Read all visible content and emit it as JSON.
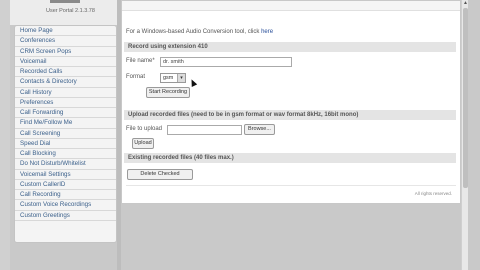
{
  "app": {
    "version": "User Portal 2.1.3.78"
  },
  "sidebar": {
    "items": [
      {
        "label": "Home Page"
      },
      {
        "label": "Conferences"
      },
      {
        "label": "CRM Screen Pops"
      },
      {
        "label": "Voicemail"
      },
      {
        "label": "Recorded Calls"
      },
      {
        "label": "Contacts & Directory"
      },
      {
        "label": "Call History"
      },
      {
        "label": "Preferences"
      },
      {
        "label": "Call Forwarding"
      },
      {
        "label": "Find Me/Follow Me"
      },
      {
        "label": "Call Screening"
      },
      {
        "label": "Speed Dial"
      },
      {
        "label": "Call Blocking"
      },
      {
        "label": "Do Not Disturb/Whitelist"
      },
      {
        "label": "Voicemail Settings"
      },
      {
        "label": "Custom CallerID"
      },
      {
        "label": "Call Recording"
      },
      {
        "label": "Custom Voice Recordings"
      },
      {
        "label": "Custom Greetings"
      }
    ]
  },
  "main": {
    "conversion_text": "For a Windows-based Audio Conversion tool, click",
    "conversion_link": "here",
    "record_section": {
      "title": "Record using extension 410",
      "file_name_label": "File name*",
      "file_name_value": "dr. smith",
      "format_label": "Format",
      "format_value": "gsm",
      "start_button": "Start Recording"
    },
    "upload_section": {
      "title": "Upload recorded files (need to be in gsm format or wav format 8kHz, 16bit mono)",
      "file_label": "File to upload",
      "browse_button": "Browse...",
      "upload_button": "Upload"
    },
    "existing_section": {
      "title": "Existing recorded files (40 files max.)",
      "delete_button": "Delete Checked"
    },
    "rights": "All rights reserved."
  },
  "colors": {
    "link": "#2a4f9a",
    "sidebar_text": "#3a5f8a",
    "section_bar": "#e4e4e4"
  }
}
